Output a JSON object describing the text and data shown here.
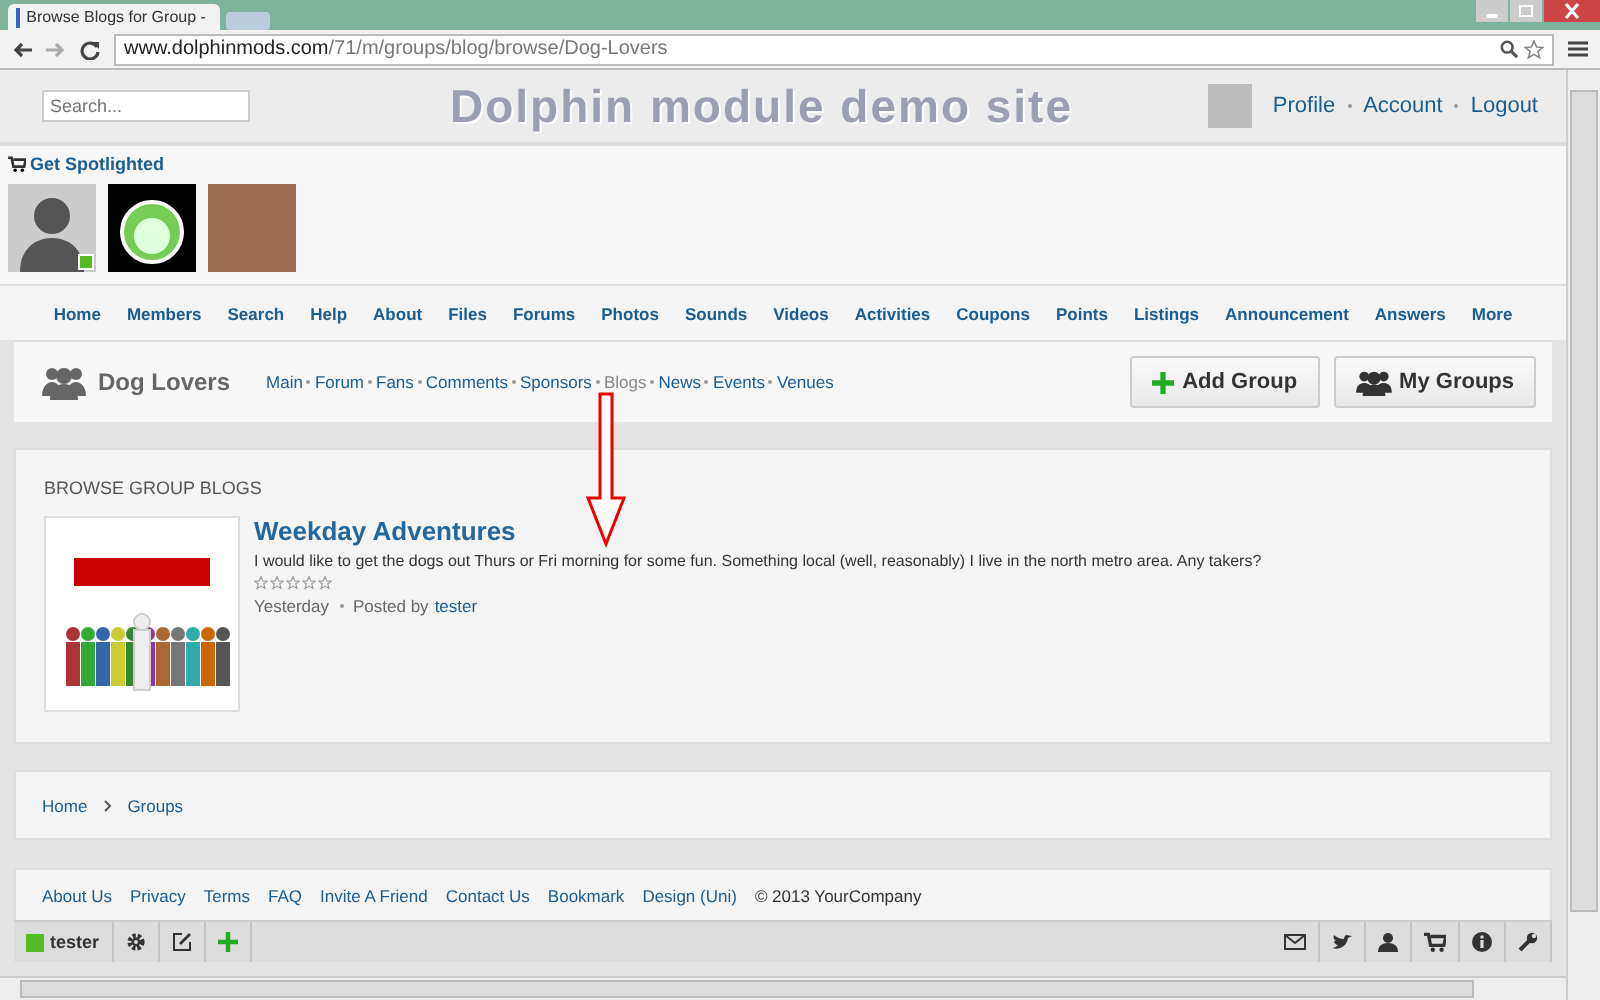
{
  "browser": {
    "tab_title": "Browse Blogs for Group - ",
    "url_domain": "www.dolphinmods.com",
    "url_path": "/71/m/groups/blog/browse/Dog-Lovers"
  },
  "header": {
    "search": {
      "placeholder": "Search..."
    },
    "site_title": "Dolphin module demo site",
    "user_links": [
      "Profile",
      "Account",
      "Logout"
    ]
  },
  "spotlight": {
    "title": "Get Spotlighted",
    "members": [
      {
        "kind": "silhouette",
        "online": true
      },
      {
        "kind": "cartoon",
        "online": false
      },
      {
        "kind": "photo",
        "online": false
      }
    ]
  },
  "nav": [
    "Home",
    "Members",
    "Search",
    "Help",
    "About",
    "Files",
    "Forums",
    "Photos",
    "Sounds",
    "Videos",
    "Activities",
    "Coupons",
    "Points",
    "Listings",
    "Announcement",
    "Answers",
    "More"
  ],
  "group": {
    "name": "Dog Lovers",
    "tabs": [
      {
        "label": "Main",
        "selected": false
      },
      {
        "label": "Forum",
        "selected": false
      },
      {
        "label": "Fans",
        "selected": false
      },
      {
        "label": "Comments",
        "selected": false
      },
      {
        "label": "Sponsors",
        "selected": false
      },
      {
        "label": "Blogs",
        "selected": true
      },
      {
        "label": "News",
        "selected": false
      },
      {
        "label": "Events",
        "selected": false
      },
      {
        "label": "Venues",
        "selected": false
      }
    ],
    "buttons": [
      {
        "kind": "add",
        "label": "Add Group"
      },
      {
        "kind": "groups",
        "label": "My Groups"
      }
    ]
  },
  "blogs": {
    "heading": "BROWSE GROUP BLOGS",
    "posts": [
      {
        "title": "Weekday Adventures",
        "text": "I would like to get the dogs out Thurs or Fri morning for some fun. Something local (well, reasonably) I live in the north metro area. Any takers?",
        "stars": 0,
        "date": "Yesterday",
        "posted_by": "Posted by",
        "author": "tester"
      }
    ]
  },
  "breadcrumb": [
    "Home",
    "Groups"
  ],
  "footer": {
    "links": [
      "About Us",
      "Privacy",
      "Terms",
      "FAQ",
      "Invite A Friend",
      "Contact Us",
      "Bookmark",
      "Design (Uni)"
    ],
    "copyright": "© 2013 YourCompany"
  },
  "toolbar": {
    "user": "tester",
    "online": true
  }
}
